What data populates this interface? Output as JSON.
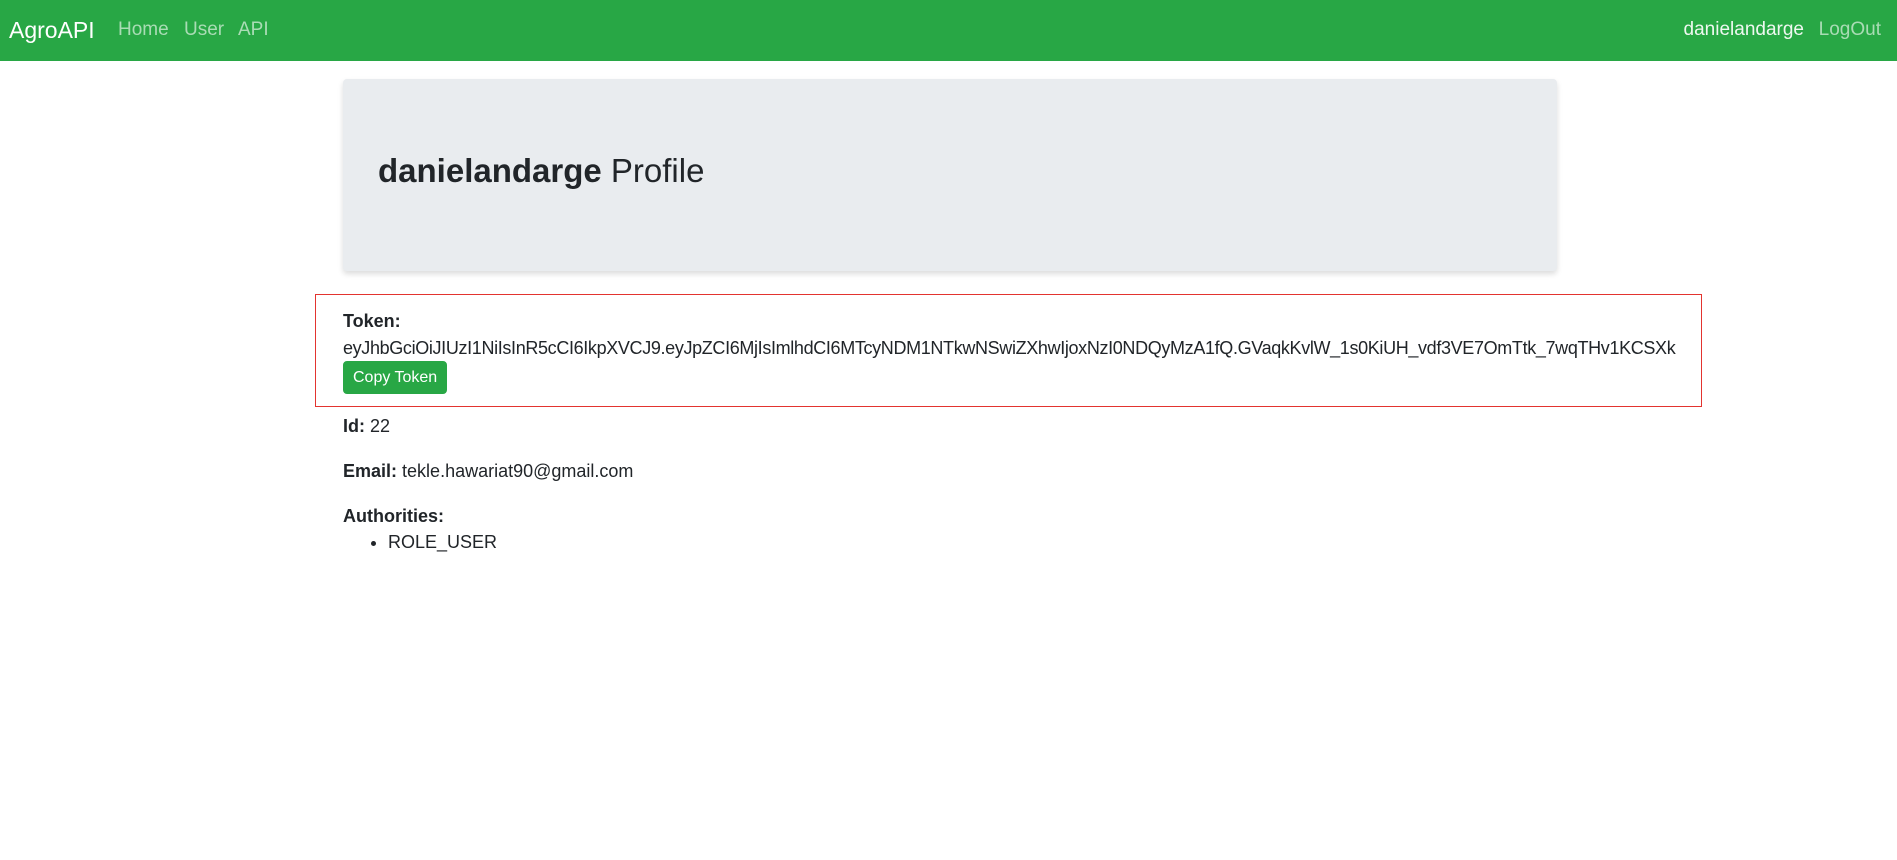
{
  "navbar": {
    "brand": "AgroAPI",
    "links": [
      {
        "label": "Home"
      },
      {
        "label": "User"
      },
      {
        "label": "API"
      }
    ],
    "username": "danielandarge",
    "logout_label": "LogOut",
    "background_color": "#28a745"
  },
  "profile": {
    "username": "danielandarge",
    "title_suffix": "Profile"
  },
  "token": {
    "label": "Token:",
    "value": "eyJhbGciOiJIUzI1NiIsInR5cCI6IkpXVCJ9.eyJpZCI6MjIsImlhdCI6MTcyNDM1NTkwNSwiZXhwIjoxNzI0NDQyMzA1fQ.GVaqkKvlW_1s0KiUH_vdf3VE7OmTtk_7wqTHv1KCSXk",
    "copy_button_label": "Copy Token",
    "highlight_color": "#e3342f"
  },
  "details": {
    "id_label": "Id:",
    "id_value": "22",
    "email_label": "Email:",
    "email_value": "tekle.hawariat90@gmail.com",
    "authorities_label": "Authorities:",
    "authorities": [
      "ROLE_USER"
    ]
  }
}
